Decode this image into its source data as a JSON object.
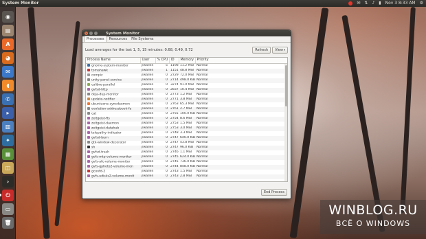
{
  "top_panel": {
    "app_title": "System Monitor",
    "clock": "Nov 3  8:33 AM"
  },
  "window": {
    "title": "System Monitor",
    "tabs": [
      "Processes",
      "Resources",
      "File Systems"
    ],
    "load_averages": "Load averages for the last 1, 5, 15 minutes: 0.68, 0.49, 0.72",
    "refresh_label": "Refresh",
    "view_label": "View",
    "end_process_label": "End Process",
    "columns": [
      "Process Name",
      "User",
      "% CPU",
      "ID",
      "Memory",
      "Priority"
    ],
    "processes": [
      {
        "name": "gnome-system-monitor",
        "user": "jlwallen",
        "cpu": "5",
        "id": "11983",
        "mem": "11.2 MiB",
        "pri": "Normal",
        "icon": "#3b6ea8"
      },
      {
        "name": "tomahawk",
        "user": "jlwallen",
        "cpu": "1",
        "id": "11519",
        "mem": "48.8 MiB",
        "pri": "Normal",
        "icon": "#c33"
      },
      {
        "name": "compiz",
        "user": "jlwallen",
        "cpu": "0",
        "id": "27291",
        "mem": "72.0 MiB",
        "pri": "Normal",
        "icon": "#999"
      },
      {
        "name": "unity-panel-service",
        "user": "jlwallen",
        "cpu": "0",
        "id": "27146",
        "mem": "498.0 KiB",
        "pri": "Normal",
        "icon": "#888"
      },
      {
        "name": "calibre-parallel",
        "user": "jlwallen",
        "cpu": "0",
        "id": "32749",
        "mem": "91.0 MiB",
        "pri": "Normal",
        "icon": "#8a5"
      },
      {
        "name": "gvfsd-http",
        "user": "jlwallen",
        "cpu": "0",
        "id": "28374",
        "mem": "10.4 MiB",
        "pri": "Normal",
        "icon": "#a6a"
      },
      {
        "name": "deja-dup-monitor",
        "user": "jlwallen",
        "cpu": "0",
        "id": "27735",
        "mem": "1.2 MiB",
        "pri": "Normal",
        "icon": "#888"
      },
      {
        "name": "update-notifier",
        "user": "jlwallen",
        "cpu": "0",
        "id": "27710",
        "mem": "3.8 MiB",
        "pri": "Normal",
        "icon": "#c84"
      },
      {
        "name": "ubuntuone-syncdaemon",
        "user": "jlwallen",
        "cpu": "0",
        "id": "27638",
        "mem": "65.3 MiB",
        "pri": "Normal",
        "icon": "#e73"
      },
      {
        "name": "evolution-addressbook-fa",
        "user": "jlwallen",
        "cpu": "0",
        "id": "27610",
        "mem": "2.7 MiB",
        "pri": "Normal",
        "icon": "#888"
      },
      {
        "name": "cat",
        "user": "jlwallen",
        "cpu": "0",
        "id": "27554",
        "mem": "100.0 KiB",
        "pri": "Normal",
        "icon": "#888"
      },
      {
        "name": "zeitgeist-fts",
        "user": "jlwallen",
        "cpu": "0",
        "id": "27545",
        "mem": "8.6 MiB",
        "pri": "Normal",
        "icon": "#a6a"
      },
      {
        "name": "zeitgeist-daemon",
        "user": "jlwallen",
        "cpu": "0",
        "id": "27539",
        "mem": "1.5 MiB",
        "pri": "Normal",
        "icon": "#a6a"
      },
      {
        "name": "zeitgeist-datahub",
        "user": "jlwallen",
        "cpu": "0",
        "id": "27532",
        "mem": "3.0 MiB",
        "pri": "Normal",
        "icon": "#a6a"
      },
      {
        "name": "telepathy-indicator",
        "user": "jlwallen",
        "cpu": "0",
        "id": "27486",
        "mem": "3.3 MiB",
        "pri": "Normal",
        "icon": "#a6a"
      },
      {
        "name": "gvfsd-burn",
        "user": "jlwallen",
        "cpu": "0",
        "id": "27479",
        "mem": "640.0 KiB",
        "pri": "Normal",
        "icon": "#a6a"
      },
      {
        "name": "gtk-window-decorator",
        "user": "jlwallen",
        "cpu": "0",
        "id": "27474",
        "mem": "43.8 MiB",
        "pri": "Normal",
        "icon": "#888"
      },
      {
        "name": "sh",
        "user": "jlwallen",
        "cpu": "0",
        "id": "27473",
        "mem": "96.0 KiB",
        "pri": "Normal",
        "icon": "#333"
      },
      {
        "name": "gvfsd-trash",
        "user": "jlwallen",
        "cpu": "0",
        "id": "27465",
        "mem": "1.1 MiB",
        "pri": "Normal",
        "icon": "#a6a"
      },
      {
        "name": "gvfs-mtp-volume-monitor",
        "user": "jlwallen",
        "cpu": "0",
        "id": "27458",
        "mem": "624.0 KiB",
        "pri": "Normal",
        "icon": "#a6a"
      },
      {
        "name": "gvfs-afc-volume-monitor",
        "user": "jlwallen",
        "cpu": "0",
        "id": "27453",
        "mem": "736.0 KiB",
        "pri": "Normal",
        "icon": "#a6a"
      },
      {
        "name": "gvfs-gphoto2-volume-mon",
        "user": "jlwallen",
        "cpu": "0",
        "id": "27449",
        "mem": "848.0 KiB",
        "pri": "Normal",
        "icon": "#a6a"
      },
      {
        "name": "gconfd-2",
        "user": "jlwallen",
        "cpu": "0",
        "id": "27439",
        "mem": "1.5 MiB",
        "pri": "Normal",
        "icon": "#c33"
      },
      {
        "name": "gvfs-udisks2-volume-monit",
        "user": "jlwallen",
        "cpu": "0",
        "id": "27435",
        "mem": "2.8 MiB",
        "pri": "Normal",
        "icon": "#a6a"
      }
    ]
  },
  "watermark": {
    "line1": "WINBLOG.RU",
    "line2": "ВСЁ О WINDOWS"
  },
  "launcher": [
    {
      "name": "dash-icon",
      "color": "#5a5550",
      "glyph": "◉"
    },
    {
      "name": "files-icon",
      "color": "#9c8570",
      "glyph": "▤"
    },
    {
      "name": "software-center-icon",
      "color": "#e8692a",
      "glyph": "A"
    },
    {
      "name": "firefox-icon",
      "color": "#d86b1e",
      "glyph": "◕"
    },
    {
      "name": "thunderbird-icon",
      "color": "#3c78c8",
      "glyph": "✉"
    },
    {
      "name": "clementine-icon",
      "color": "#f08a2a",
      "glyph": "◖"
    },
    {
      "name": "chat-icon",
      "color": "#3a6fb0",
      "glyph": "✆"
    },
    {
      "name": "vlc-icon",
      "color": "#3b5fa8",
      "glyph": "▸"
    },
    {
      "name": "writer-icon",
      "color": "#4b7fbe",
      "glyph": "▥"
    },
    {
      "name": "app-icon",
      "color": "#2f6d9f",
      "glyph": "✦"
    },
    {
      "name": "calc-icon",
      "color": "#5a8f3a",
      "glyph": "▦"
    },
    {
      "name": "archive-icon",
      "color": "#c9a85a",
      "glyph": "◫"
    },
    {
      "name": "terminal-icon",
      "color": "#2d2b28",
      "glyph": "›"
    },
    {
      "name": "system-monitor-icon",
      "color": "#c82c2a",
      "glyph": "⏻"
    },
    {
      "name": "drive-icon",
      "color": "#8a8884",
      "glyph": "▭"
    },
    {
      "name": "trash-icon",
      "color": "#6b6b6b",
      "glyph": "🗑"
    }
  ]
}
